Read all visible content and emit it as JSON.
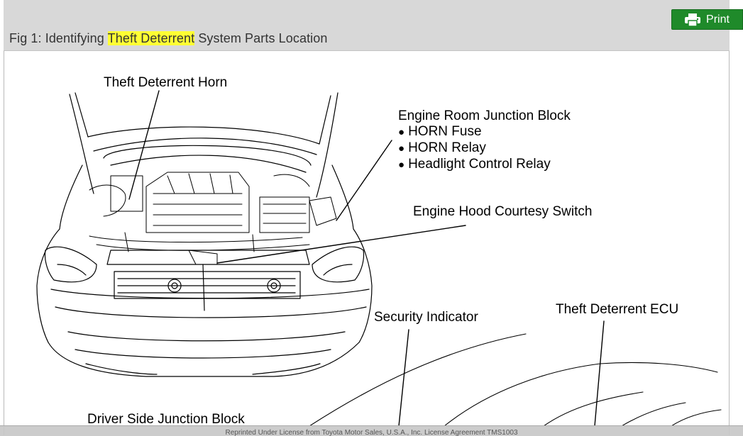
{
  "header": {
    "title_prefix": "Fig 1: Identifying ",
    "title_highlight": "Theft Deterrent",
    "title_suffix": " System Parts Location",
    "highlight_color": "#ffff33"
  },
  "print_button": {
    "label": "Print",
    "icon": "printer-icon",
    "color": "#1f8a2a"
  },
  "diagram": {
    "labels": {
      "horn": "Theft Deterrent Horn",
      "junction_block": "Engine Room Junction Block",
      "junction_items": [
        "HORN Fuse",
        "HORN Relay",
        "Headlight Control Relay"
      ],
      "hood_switch": "Engine Hood Courtesy Switch",
      "security_indicator": "Security Indicator",
      "ecu": "Theft Deterrent ECU",
      "driver_junction": "Driver Side Junction Block"
    }
  },
  "footer": {
    "text": "Reprinted Under License from Toyota Motor Sales, U.S.A., Inc. License Agreement TMS1003"
  }
}
